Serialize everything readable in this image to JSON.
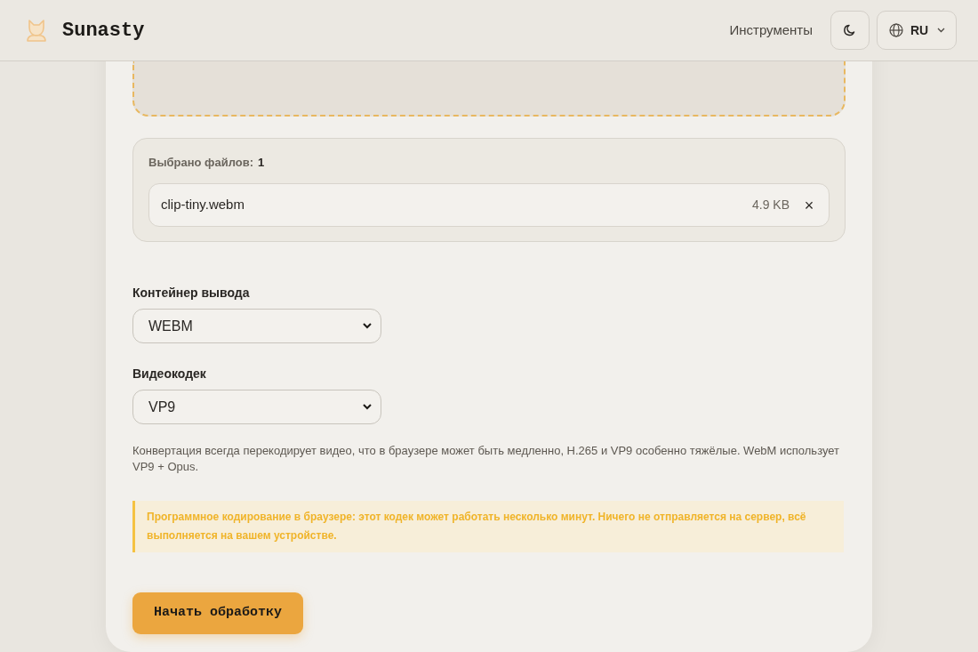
{
  "header": {
    "brand": "Sunasty",
    "nav_link": "Инструменты",
    "language": "RU"
  },
  "files": {
    "label": "Выбрано файлов:",
    "count": "1",
    "items": [
      {
        "name": "clip-tiny.webm",
        "size": "4.9 KB",
        "remove": "×"
      }
    ]
  },
  "fields": [
    {
      "label": "Контейнер вывода",
      "value": "WEBM"
    },
    {
      "label": "Видеокодек",
      "value": "VP9"
    }
  ],
  "note": "Конвертация всегда перекодирует видео, что в браузере может быть медленно, H.265 и VP9 особенно тяжёлые. WebM использует VP9 + Opus.",
  "warning": "Программное кодирование в браузере: этот кодек может работать несколько минут. Ничего не отправляется на сервер, всё выполняется на вашем устройстве.",
  "start_button": "Начать обработку"
}
